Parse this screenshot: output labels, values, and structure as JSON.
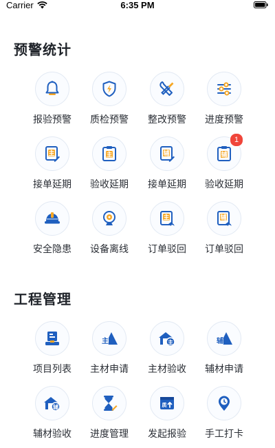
{
  "status_bar": {
    "carrier": "Carrier",
    "time": "6:35 PM"
  },
  "sections": [
    {
      "title": "预警统计",
      "items": [
        {
          "label": "报验预警",
          "icon": "bell-icon"
        },
        {
          "label": "质检预警",
          "icon": "shield-lightning-icon"
        },
        {
          "label": "整改预警",
          "icon": "tools-icon"
        },
        {
          "label": "进度预警",
          "icon": "sliders-icon"
        },
        {
          "label": "接单延期",
          "icon": "document-zhu-edit-icon"
        },
        {
          "label": "验收延期",
          "icon": "clipboard-zhu-icon"
        },
        {
          "label": "接单延期",
          "icon": "document-fu-edit-icon"
        },
        {
          "label": "验收延期",
          "icon": "clipboard-fu-icon",
          "badge": "1"
        },
        {
          "label": "安全隐患",
          "icon": "hard-hat-icon"
        },
        {
          "label": "设备离线",
          "icon": "webcam-icon"
        },
        {
          "label": "订单驳回",
          "icon": "document-zhu-return-icon"
        },
        {
          "label": "订单驳回",
          "icon": "document-fu-return-icon"
        }
      ]
    },
    {
      "title": "工程管理",
      "items": [
        {
          "label": "项目列表",
          "icon": "project-list-icon"
        },
        {
          "label": "主材申请",
          "icon": "main-material-apply-icon"
        },
        {
          "label": "主材验收",
          "icon": "main-material-accept-icon"
        },
        {
          "label": "辅材申请",
          "icon": "aux-material-apply-icon"
        },
        {
          "label": "辅材验收",
          "icon": "aux-material-accept-icon"
        },
        {
          "label": "进度管理",
          "icon": "hourglass-icon"
        },
        {
          "label": "发起报验",
          "icon": "inspection-report-icon"
        },
        {
          "label": "手工打卡",
          "icon": "location-clock-icon"
        }
      ]
    }
  ],
  "colors": {
    "primary": "#1f5fbf",
    "accent": "#f6a623",
    "badge": "#f0453a"
  }
}
